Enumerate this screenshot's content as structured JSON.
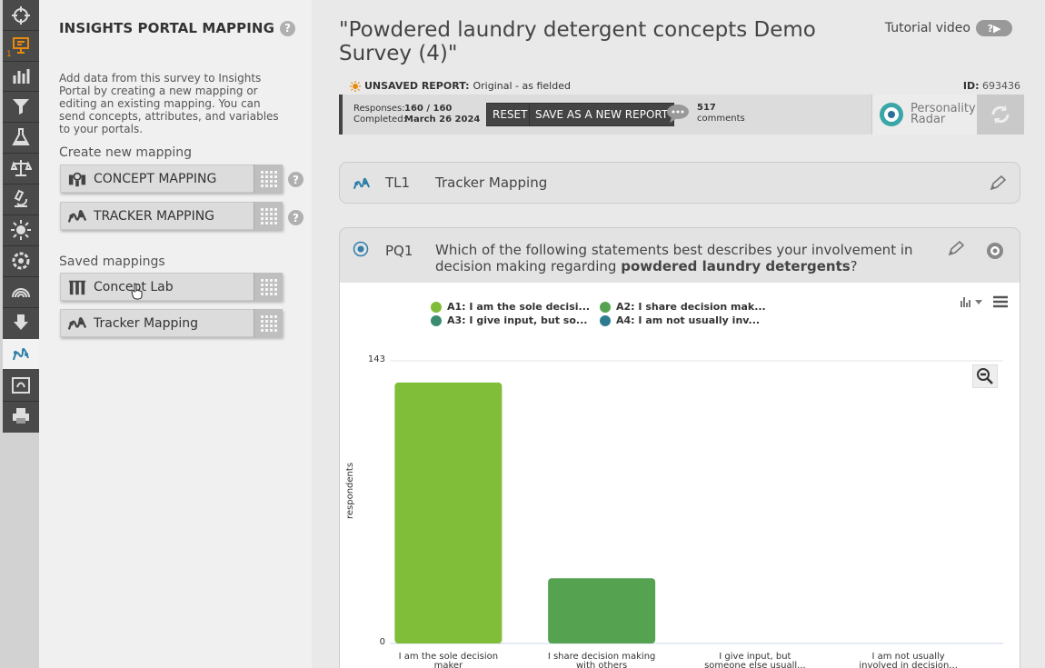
{
  "rail": {
    "items": [
      "crosshair-icon",
      "presentation-icon",
      "bar-chart-icon",
      "filter-icon",
      "flask-icon",
      "scale-icon",
      "microscope-icon",
      "sun-icon",
      "gear-icon",
      "radar-icon",
      "download-icon",
      "mapping-icon",
      "concept-icon",
      "print-icon"
    ],
    "badge": "1"
  },
  "panel": {
    "title": "INSIGHTS PORTAL MAPPING",
    "help": "?",
    "description": "Add data from this survey to Insights Portal by creating a new mapping or editing an existing mapping. You can send concepts, attributes, and variables to your portals.",
    "create_label": "Create new mapping",
    "concept_mapping": "CONCEPT MAPPING",
    "tracker_mapping": "TRACKER MAPPING",
    "saved_label": "Saved mappings",
    "saved": [
      "Concept Lab",
      "Tracker Mapping"
    ]
  },
  "header": {
    "title": "\"Powdered laundry detergent concepts Demo Survey (4)\"",
    "tutorial": "Tutorial video",
    "unsaved_label": "UNSAVED REPORT:",
    "unsaved_value": "Original - as fielded",
    "id_label": "ID:",
    "id_value": "693436"
  },
  "toolbar": {
    "responses_label": "Responses:",
    "responses_value": "160 / 160",
    "completed_label": "Completed:",
    "completed_value": "March 26 2024",
    "reset": "RESET",
    "save_new": "SAVE AS A NEW REPORT",
    "comments_count": "517",
    "comments_label": "comments",
    "personality_line1": "Personality",
    "personality_line2": "Radar"
  },
  "tl1": {
    "code": "TL1",
    "name": "Tracker Mapping"
  },
  "pq1": {
    "code": "PQ1",
    "question_pre": "Which of the following statements best describes your involvement in decision making regarding ",
    "question_bold": "powdered laundry detergents",
    "question_post": "?"
  },
  "colors": {
    "a1": "#80bd39",
    "a2": "#55a251",
    "a3": "#3a8c6e",
    "a4": "#2d7b8e",
    "accent": "#e8890c"
  },
  "chart_data": {
    "type": "bar",
    "legend": [
      "A1: I am the sole decisi...",
      "A2: I share decision mak...",
      "A3: I give input, but so...",
      "A4: I am not usually inv..."
    ],
    "categories": [
      "I am the sole decision maker",
      "I share decision making with others",
      "I give input, but someone else usuall...",
      "I am not usually involved in decision..."
    ],
    "category_lines": [
      [
        "I am the sole decision",
        "maker"
      ],
      [
        "I share decision making",
        "with others"
      ],
      [
        "I give input, but",
        "someone else usuall..."
      ],
      [
        "I am not usually",
        "involved in decision..."
      ]
    ],
    "values": [
      132,
      33,
      0,
      0
    ],
    "ylabel": "respondents",
    "ylim": [
      0,
      143
    ],
    "yticks": [
      "143",
      "0"
    ],
    "legend_placement": "top"
  }
}
